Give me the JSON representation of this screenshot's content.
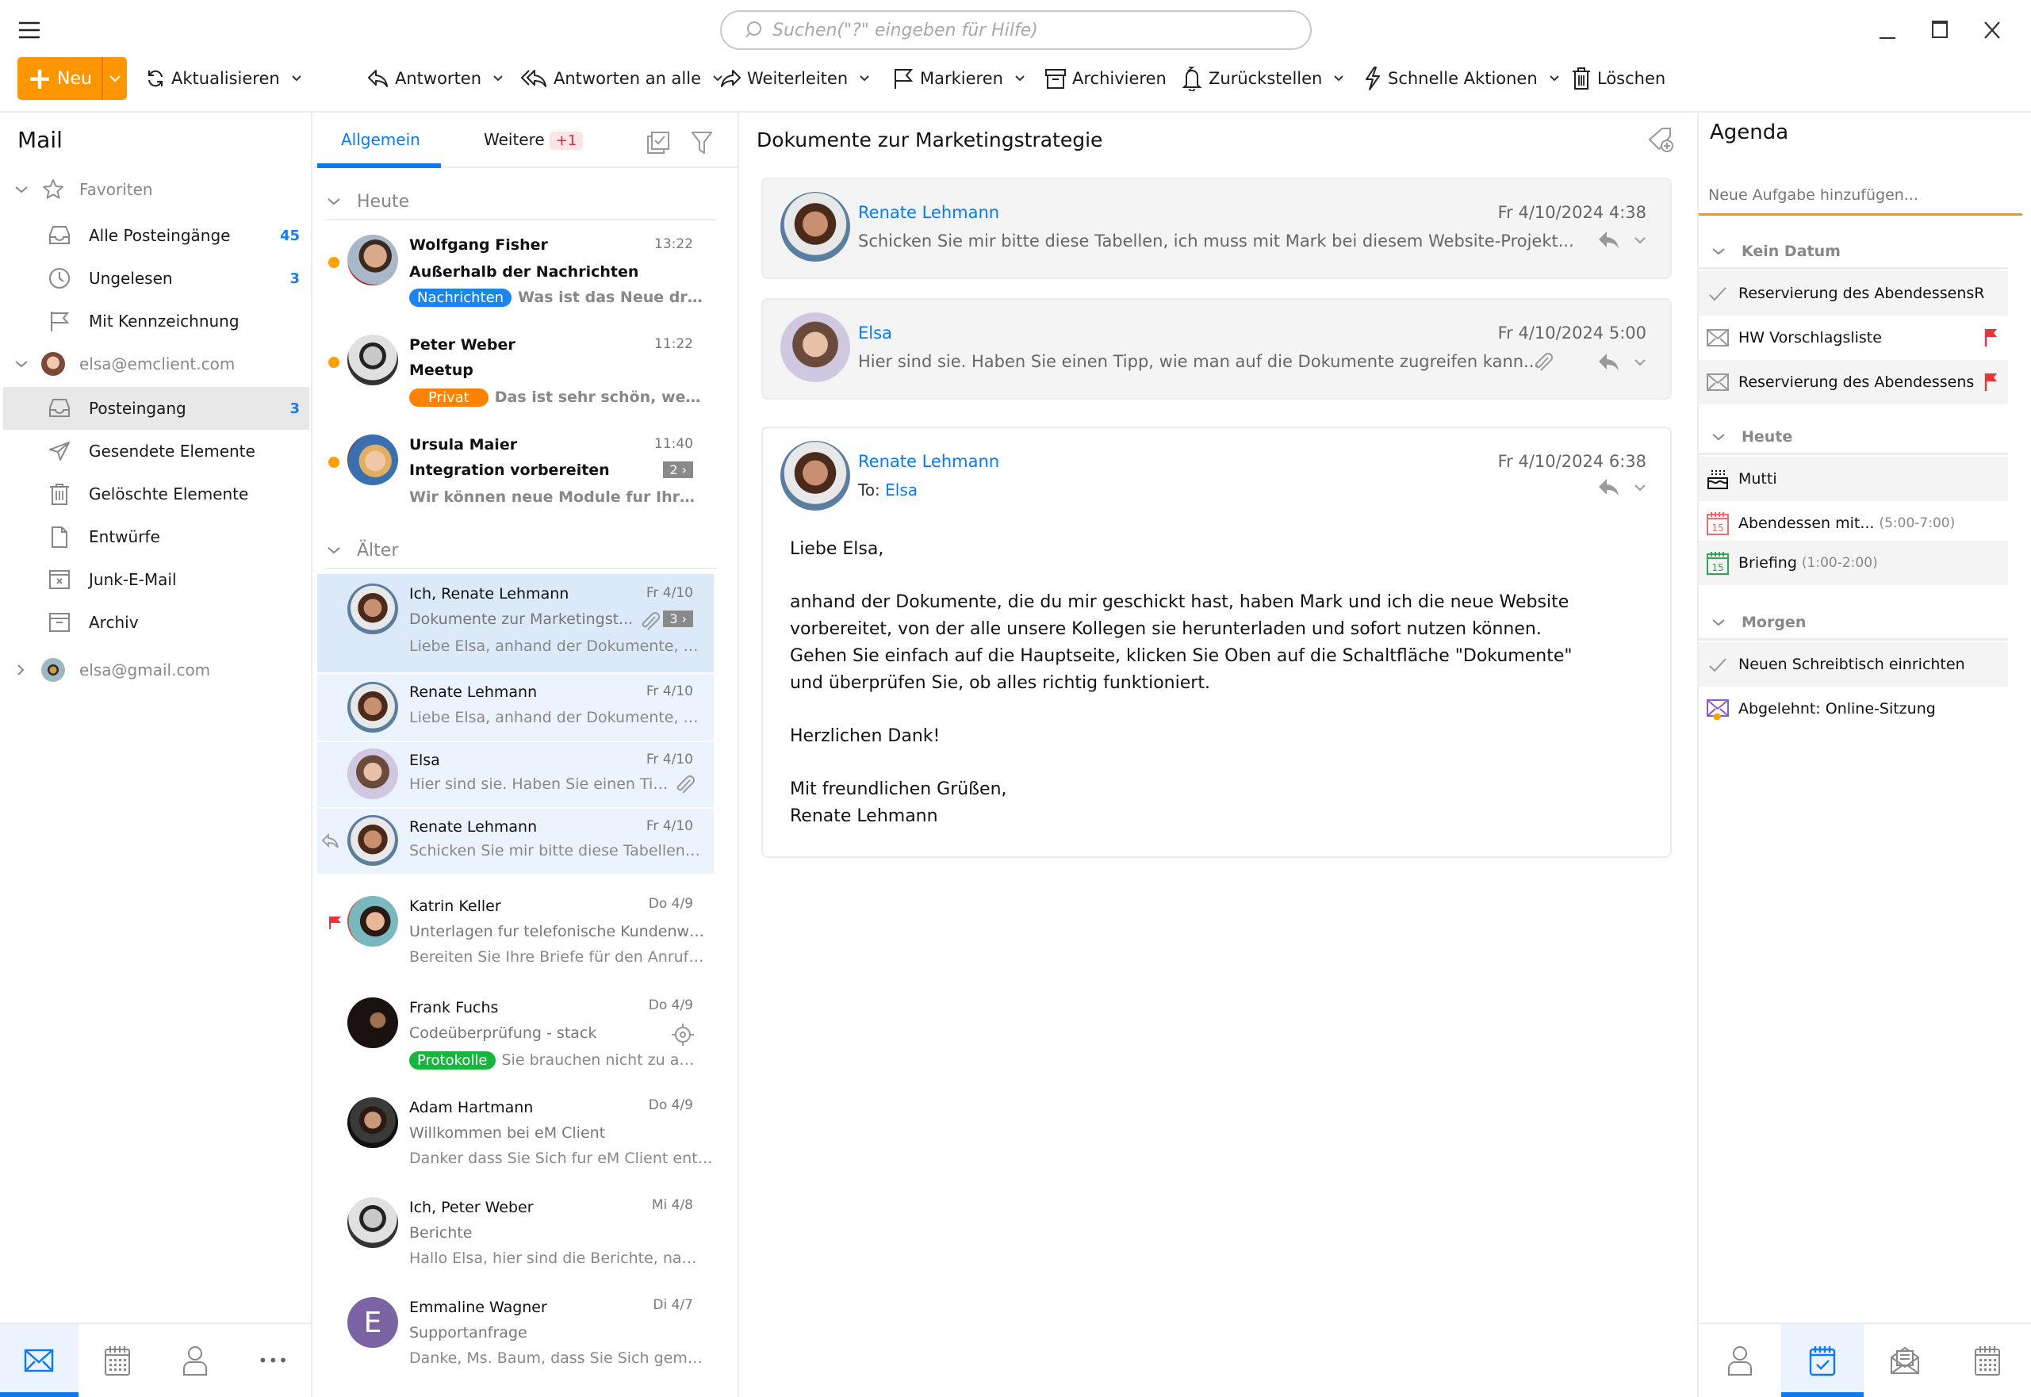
{
  "titlebar": {
    "search_placeholder": "Suchen(\"?\" eingeben für Hilfe)"
  },
  "toolbar": {
    "new_label": "Neu",
    "refresh_label": "Aktualisieren",
    "reply_label": "Antworten",
    "reply_all_label": "Antworten an alle",
    "forward_label": "Weiterleiten",
    "flag_label": "Markieren",
    "archive_label": "Archivieren",
    "snooze_label": "Zurückstellen",
    "quick_actions_label": "Schnelle Aktionen",
    "delete_label": "Löschen"
  },
  "sidebar": {
    "title": "Mail",
    "favorites": {
      "label": "Favoriten",
      "items": [
        {
          "label": "Alle Posteingänge",
          "count": "45",
          "icon": "inbox-icon"
        },
        {
          "label": "Ungelesen",
          "count": "3",
          "icon": "clock-icon"
        },
        {
          "label": "Mit Kennzeichnung",
          "count": "",
          "icon": "flag-icon"
        }
      ]
    },
    "account1": {
      "label": "elsa@emclient.com",
      "items": [
        {
          "label": "Posteingang",
          "count": "3",
          "icon": "inbox-icon",
          "active": true
        },
        {
          "label": "Gesendete Elemente",
          "count": "",
          "icon": "send-icon"
        },
        {
          "label": "Gelöschte Elemente",
          "count": "",
          "icon": "trash-icon"
        },
        {
          "label": "Entwürfe",
          "count": "",
          "icon": "draft-icon"
        },
        {
          "label": "Junk-E-Mail",
          "count": "",
          "icon": "junk-icon"
        },
        {
          "label": "Archiv",
          "count": "",
          "icon": "archive-icon"
        }
      ]
    },
    "account2": {
      "label": "elsa@gmail.com"
    },
    "bottom_nav": [
      "mail",
      "calendar",
      "contacts",
      "more"
    ],
    "more_label": "•••"
  },
  "msglist": {
    "tabs": [
      {
        "label": "Allgemein",
        "active": true
      },
      {
        "label": "Weitere",
        "badge": "+1"
      }
    ],
    "groups": {
      "today": "Heute",
      "older": "Älter"
    },
    "messages": [
      {
        "from": "Wolfgang Fisher",
        "date": "13:22",
        "subject": "Außerhalb der Nachrichten",
        "tag": "Nachrichten",
        "tag_color": "#1a84f0",
        "preview": "Was ist das Neue dra...",
        "unread": true
      },
      {
        "from": "Peter Weber",
        "date": "11:22",
        "subject": "Meetup",
        "tag": "Privat",
        "tag_color": "#ff8200",
        "preview": "Das ist sehr schön, wenn...",
        "unread": true
      },
      {
        "from": "Ursula Maier",
        "date": "11:40",
        "subject": "Integration vorbereiten",
        "count": "2 ›",
        "preview": "Wir können neue Module fur Ihren...",
        "unread": true
      },
      {
        "from": "Ich, Renate Lehmann",
        "date": "Fr 4/10",
        "subject": "Dokumente zur Marketingst...",
        "count": "3 ›",
        "attachment": true,
        "preview": "Liebe Elsa, anhand der Dokumente, di...",
        "selected": true
      },
      {
        "from": "Renate Lehmann",
        "date": "Fr 4/10",
        "preview": "Liebe Elsa, anhand der Dokumente, di..."
      },
      {
        "from": "Elsa",
        "date": "Fr 4/10",
        "preview": "Hier sind sie. Haben Sie einen Tipp...",
        "attachment": true
      },
      {
        "from": "Renate Lehmann",
        "date": "Fr 4/10",
        "preview": "Schicken Sie mir bitte diese Tabellen, i...",
        "replied": true
      },
      {
        "from": "Katrin Keller",
        "date": "Do 4/9",
        "subject": "Unterlagen fur telefonische Kundenwe...",
        "preview": "Bereiten Sie Ihre Briefe für den Anrufe ...",
        "flagged": true
      },
      {
        "from": "Frank Fuchs",
        "date": "Do 4/9",
        "subject": "Codeüberprüfung - stack",
        "tag": "Protokolle",
        "tag_color": "#16b53c",
        "preview": "Sie brauchen nicht zu an...",
        "tracked": true
      },
      {
        "from": "Adam Hartmann",
        "date": "Do 4/9",
        "subject": "Willkommen bei eM Client",
        "preview": "Danker dass Sie Sich fur eM Client ents..."
      },
      {
        "from": "Ich, Peter Weber",
        "date": "Mi 4/8",
        "subject": "Berichte",
        "preview": "Hallo Elsa, hier sind die Berichte, nac..."
      },
      {
        "from": "Emmaline Wagner",
        "date": "Di 4/7",
        "subject": "Supportanfrage",
        "preview": "Danke, Ms. Baum, dass Sie Sich geme...",
        "initial": "E"
      }
    ]
  },
  "reader": {
    "subject": "Dokumente zur Marketingstrategie",
    "messages": [
      {
        "sender": "Renate Lehmann",
        "date": "Fr 4/10/2024 4:38",
        "snippet": "Schicken Sie mir bitte diese Tabellen, ich muss mit Mark bei diesem Website-Projekt..."
      },
      {
        "sender": "Elsa",
        "date": "Fr 4/10/2024 5:00",
        "snippet": "Hier sind sie. Haben Sie einen Tipp, wie man auf die Dokumente zugreifen kann...",
        "attachment": true
      },
      {
        "sender": "Renate Lehmann",
        "date": "Fr 4/10/2024 6:38",
        "to_label": "To:",
        "to": "Elsa",
        "body": [
          "Liebe Elsa,",
          "anhand der Dokumente, die du mir geschickt hast, haben Mark und ich die neue Website vorbereitet, von der alle unsere Kollegen sie herunterladen und sofort nutzen können. Gehen Sie einfach auf die Hauptseite, klicken Sie Oben auf die Schaltfläche \"Dokumente\" und überprüfen Sie, ob alles richtig funktioniert.",
          "Herzlichen Dank!",
          "Mit freundlichen Grüßen,\nRenate Lehmann"
        ]
      }
    ]
  },
  "agenda": {
    "title": "Agenda",
    "task_placeholder": "Neue Aufgabe hinzufügen...",
    "groups": [
      {
        "label": "Kein Datum",
        "items": [
          {
            "label": "Reservierung des AbendessensR",
            "icon": "check-icon"
          },
          {
            "label": "HW Vorschlagsliste",
            "icon": "mail-icon",
            "flagged": true
          },
          {
            "label": "Reservierung des Abendessens",
            "icon": "mail-icon",
            "flagged": true
          }
        ]
      },
      {
        "label": "Heute",
        "items": [
          {
            "label": "Mutti",
            "icon": "birthday-cake-icon"
          },
          {
            "label": "Abendessen mit...",
            "time": "(5:00-7:00)",
            "icon": "calendar-red-icon",
            "day": "15"
          },
          {
            "label": "Briefing",
            "time": "(1:00-2:00)",
            "icon": "calendar-green-icon",
            "day": "15"
          }
        ]
      },
      {
        "label": "Morgen",
        "items": [
          {
            "label": "Neuen Schreibtisch einrichten",
            "icon": "check-icon"
          },
          {
            "label": "Abgelehnt: Online-Sitzung",
            "icon": "declined-invite-icon"
          }
        ]
      }
    ]
  },
  "colors": {
    "accent": "#0a7af2",
    "new_button": "#ff9600",
    "unread_dot": "#ffa000",
    "flag": "#e8343a"
  }
}
